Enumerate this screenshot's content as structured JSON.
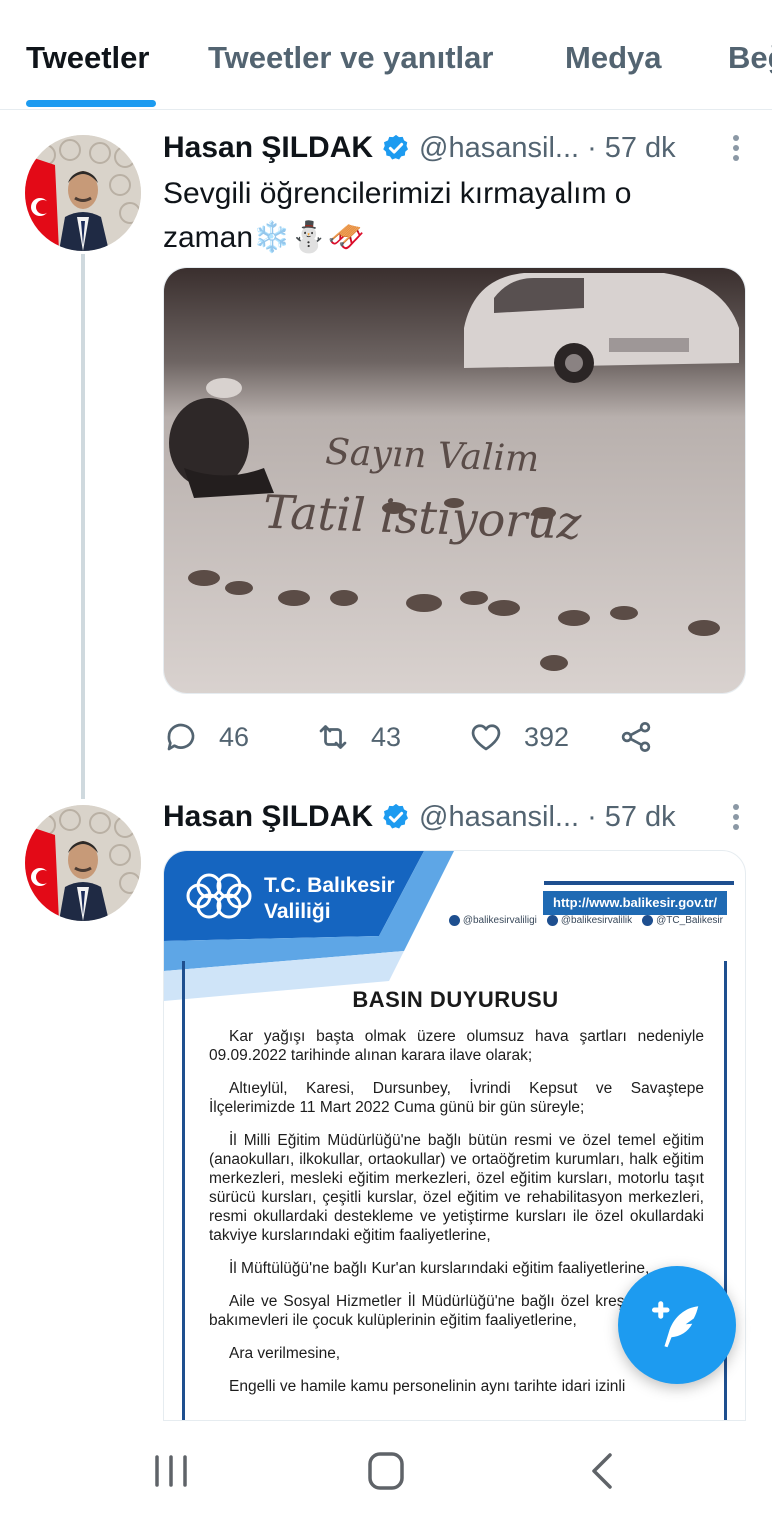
{
  "tabs": [
    {
      "label": "Tweetler",
      "active": true
    },
    {
      "label": "Tweetler ve yanıtlar",
      "active": false
    },
    {
      "label": "Medya",
      "active": false
    },
    {
      "label": "Beğeniler",
      "active": false
    }
  ],
  "accent_color": "#1d9bf0",
  "tweets": [
    {
      "display_name": "Hasan ŞILDAK",
      "handle": "@hasansil...",
      "separator": "·",
      "time": "57 dk",
      "text": "Sevgili öğrencilerimizi kırmayalım o zaman❄️⛄🛷",
      "photo_caption_in_snow": [
        "Sayın Valim",
        "Tatil istiyoruz"
      ],
      "actions": {
        "replies": "46",
        "retweets": "43",
        "likes": "392"
      }
    },
    {
      "display_name": "Hasan ŞILDAK",
      "handle": "@hasansil...",
      "separator": "·",
      "time": "57 dk",
      "document": {
        "org_line1": "T.C. Balıkesir",
        "org_line2": "Valiliği",
        "url": "http://www.balikesir.gov.tr/",
        "socials": [
          "@balikesirvaliligi",
          "@balikesirvalilik",
          "@TC_Balikesir"
        ],
        "title": "BASIN DUYURUSU",
        "paragraphs": [
          "Kar yağışı başta olmak üzere olumsuz hava şartları nedeniyle 09.09.2022 tarihinde alınan karara ilave olarak;",
          "Altıeylül, Karesi, Dursunbey, İvrindi Kepsut ve Savaştepe İlçelerimizde 11 Mart 2022 Cuma günü bir gün süreyle;",
          "İl Milli Eğitim Müdürlüğü'ne bağlı bütün resmi ve özel temel eğitim (anaokulları, ilkokullar, ortaokullar) ve ortaöğretim kurumları, halk eğitim merkezleri, mesleki eğitim merkezleri, özel eğitim kursları, motorlu taşıt sürücü kursları, çeşitli kurslar, özel eğitim ve rehabilitasyon merkezleri, resmi okullardaki destekleme ve yetiştirme kursları ile özel okullardaki takviye kurslarındaki eğitim faaliyetlerine,",
          "İl Müftülüğü'ne bağlı Kur'an kurslarındaki eğitim faaliyetlerine,",
          "Aile ve Sosyal Hizmetler İl Müdürlüğü'ne bağlı özel kreş ve gündüz bakımevleri ile çocuk kulüplerinin eğitim faaliyetlerine,",
          "Ara verilmesine,",
          "Engelli ve hamile kamu personelinin aynı tarihte idari izinli"
        ]
      }
    }
  ],
  "fab": {
    "icon": "compose-feather-icon"
  },
  "navbar": {
    "icons": [
      "recent-apps-icon",
      "home-icon",
      "back-icon"
    ]
  }
}
